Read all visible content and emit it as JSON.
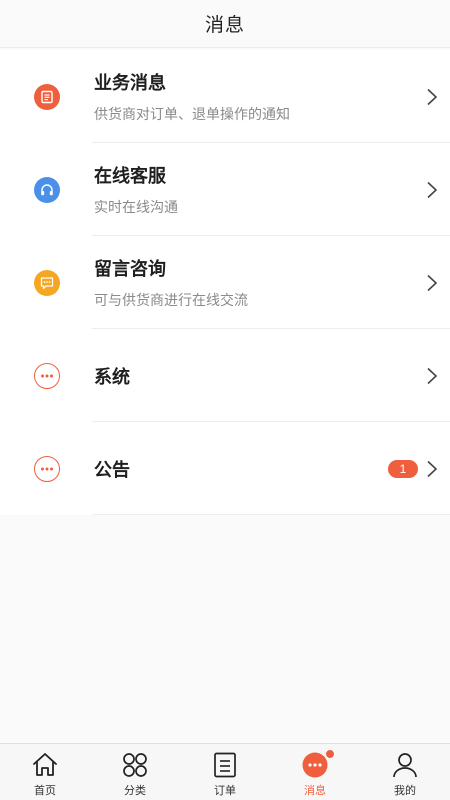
{
  "header": {
    "title": "消息"
  },
  "messages": [
    {
      "title": "业务消息",
      "subtitle": "供货商对订单、退单操作的通知",
      "icon": "document-icon",
      "color": "#f05f3d"
    },
    {
      "title": "在线客服",
      "subtitle": "实时在线沟通",
      "icon": "headset-icon",
      "color": "#4a90e8"
    },
    {
      "title": "留言咨询",
      "subtitle": "可与供货商进行在线交流",
      "icon": "chat-bubble-icon",
      "color": "#f5a623"
    },
    {
      "title": "系统",
      "subtitle": "",
      "icon": "more-dots-icon",
      "color": "#f05f3d"
    },
    {
      "title": "公告",
      "subtitle": "",
      "icon": "more-dots-icon",
      "color": "#f05f3d",
      "badge": "1"
    }
  ],
  "tabbar": {
    "active": "消息",
    "accent": "#f05f3d",
    "tabs": [
      {
        "label": "首页",
        "icon": "home-icon"
      },
      {
        "label": "分类",
        "icon": "category-grid-icon"
      },
      {
        "label": "订单",
        "icon": "order-list-icon"
      },
      {
        "label": "消息",
        "icon": "message-bubble-icon"
      },
      {
        "label": "我的",
        "icon": "user-icon"
      }
    ]
  }
}
